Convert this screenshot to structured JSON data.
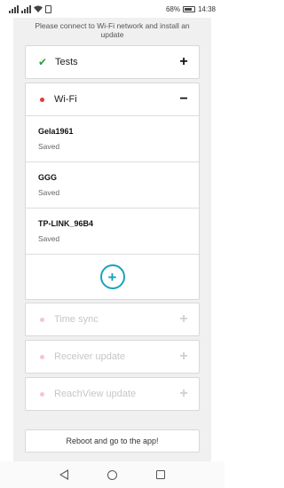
{
  "status_bar": {
    "battery": "68%",
    "time": "14:38"
  },
  "intro_text": "Please connect to Wi-Fi network and install an update",
  "sections": {
    "tests": {
      "title": "Tests",
      "toggle": "+"
    },
    "wifi": {
      "title": "Wi-Fi",
      "toggle": "−",
      "networks": [
        {
          "name": "Gela1961",
          "status": "Saved"
        },
        {
          "name": "GGG",
          "status": "Saved"
        },
        {
          "name": "TP-LINK_96B4",
          "status": "Saved"
        }
      ],
      "add_label": "+"
    },
    "time_sync": {
      "title": "Time sync",
      "toggle": "+"
    },
    "receiver_update": {
      "title": "Receiver update",
      "toggle": "+"
    },
    "reachview_update": {
      "title": "ReachView update",
      "toggle": "+"
    }
  },
  "reboot_button": "Reboot and go to the app!",
  "colors": {
    "accent": "#1aa3b8",
    "check": "#2a9d3c",
    "dot": "#e53935",
    "dot_faded": "#f6c6cc"
  }
}
